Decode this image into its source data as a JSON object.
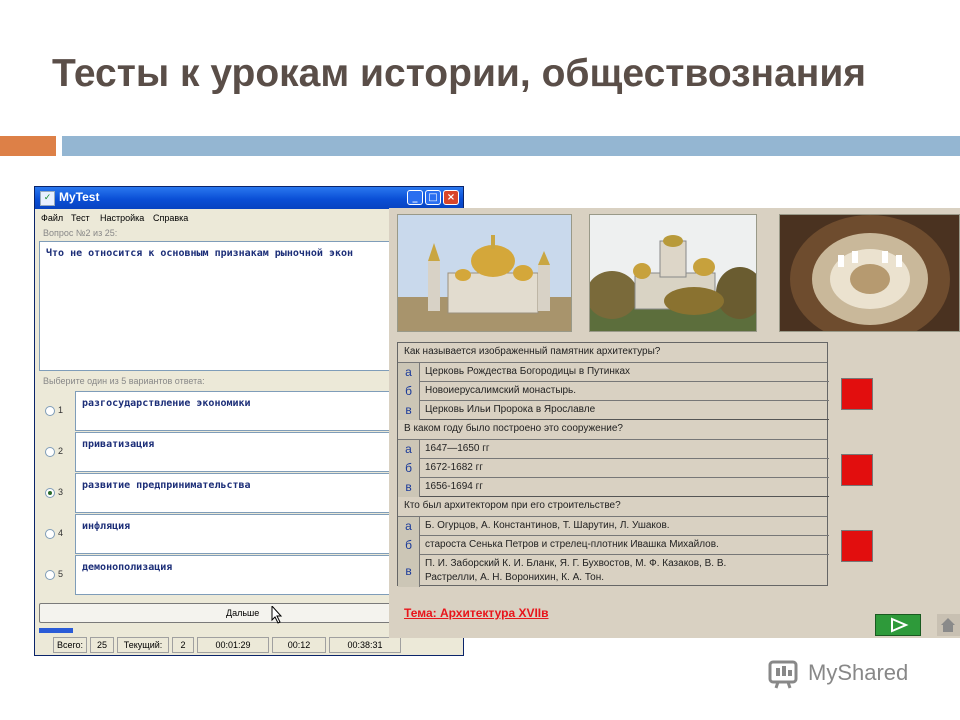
{
  "slide": {
    "title": "Тесты к урокам истории, обществознания"
  },
  "mytest": {
    "window_title": "MyTest",
    "menu": [
      "Файл",
      "Тест",
      "Настройка",
      "Справка"
    ],
    "question_number": "Вопрос №2 из 25:",
    "question_text": "Что не относится к основным признакам рыночной экон",
    "choose_label": "Выберите один из 5 вариантов ответа:",
    "options": [
      {
        "num": "1",
        "text": "разгосударствление экономики",
        "selected": false
      },
      {
        "num": "2",
        "text": "приватизация",
        "selected": false
      },
      {
        "num": "3",
        "text": "развитие предпринимательства",
        "selected": true
      },
      {
        "num": "4",
        "text": "инфляция",
        "selected": false
      },
      {
        "num": "5",
        "text": "демонополизация",
        "selected": false
      }
    ],
    "next_label": "Дальше",
    "status": {
      "total_label": "Всего:",
      "total": "25",
      "current_label": "Текущий:",
      "current": "2",
      "time1": "00:01:29",
      "time2": "00:12",
      "time3": "00:38:31"
    }
  },
  "quiz": {
    "q1": "Как называется изображенный памятник архитектуры?",
    "q1_options": [
      {
        "letter": "а",
        "text": "Церковь Рождества Богородицы в Путинках"
      },
      {
        "letter": "б",
        "text": "Новоиерусалимский монастырь."
      },
      {
        "letter": "в",
        "text": "Церковь Ильи Пророка в Ярославле"
      }
    ],
    "q2": "В каком году было построено это сооружение?",
    "q2_options": [
      {
        "letter": "а",
        "text": "1647—1650 гг"
      },
      {
        "letter": "б",
        "text": "1672-1682 гг"
      },
      {
        "letter": "в",
        "text": "1656-1694 гг"
      }
    ],
    "q3": "Кто был архитектором при его строительстве?",
    "q3_options": [
      {
        "letter": "а",
        "text": "Б. Огурцов, А. Константинов, Т. Шарутин, Л. Ушаков."
      },
      {
        "letter": "б",
        "text": "староста Сенька Петров и стрелец-плотник Ивашка Михайлов."
      },
      {
        "letter": "в",
        "text": "П. И. Заборский К. И. Бланк, Я. Г. Бухвостов, М. Ф. Казаков, В. В.",
        "text2": "Растрелли, А. Н. Воронихин, К. А. Тон."
      }
    ],
    "topic": "Тема: Архитектура XVIIв"
  },
  "colors": {
    "accent_orange": "#dd8047",
    "accent_blue": "#94b6d2",
    "answer_red": "#e20e0e",
    "nav_green": "#2e9a3a",
    "title_color": "#5a4e48"
  },
  "icons": [
    "app-icon",
    "minimize-icon",
    "maximize-icon",
    "close-icon",
    "cursor-icon",
    "play-icon",
    "home-icon",
    "myshared-logo-icon"
  ],
  "watermark": "MyShared"
}
